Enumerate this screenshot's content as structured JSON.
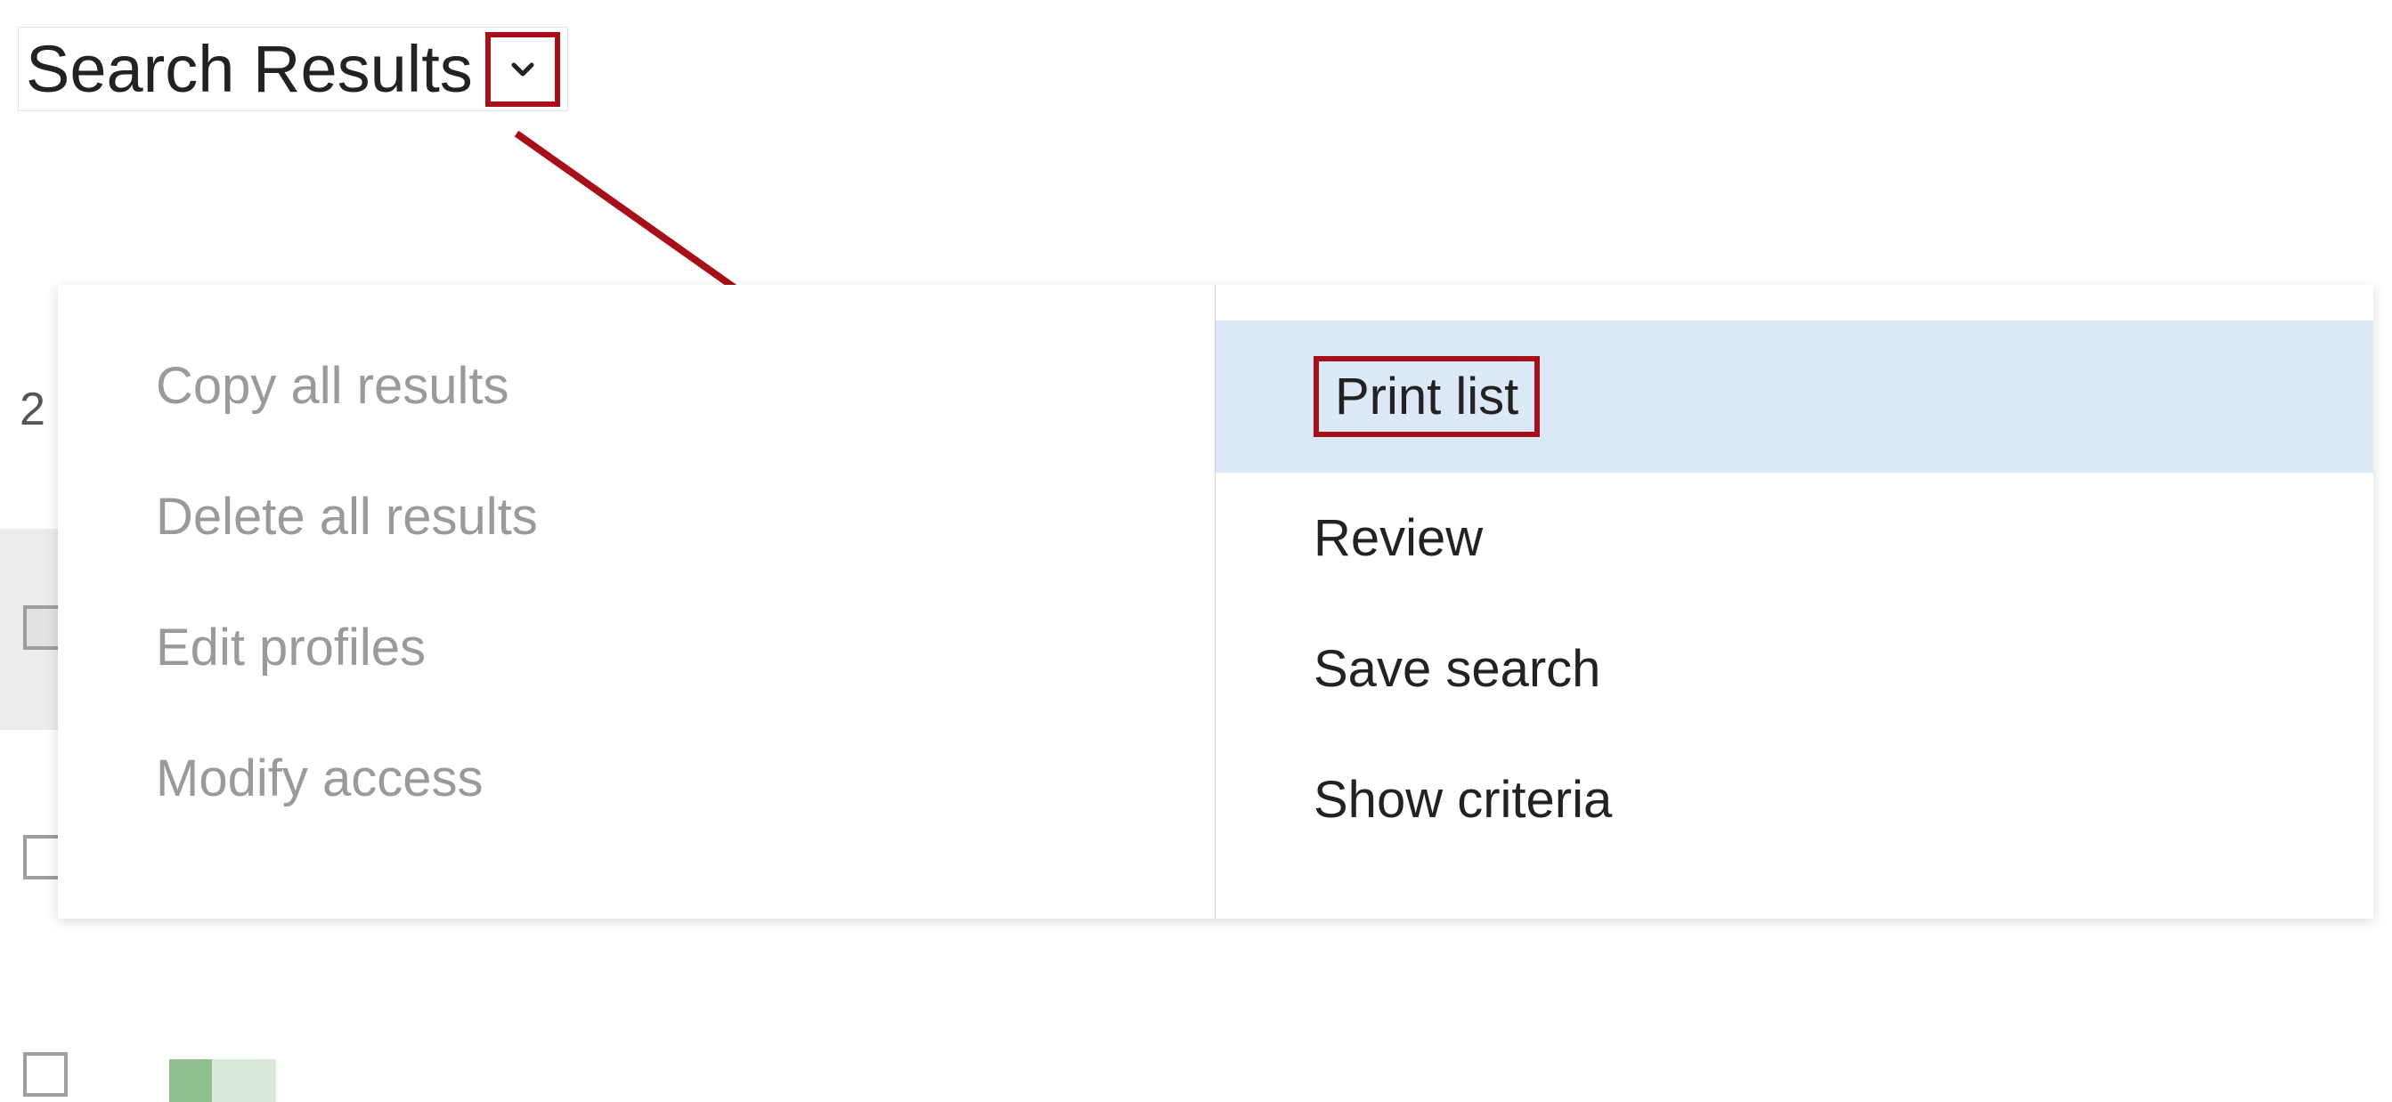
{
  "header": {
    "title": "Search Results"
  },
  "background": {
    "count_fragment": "2"
  },
  "menu": {
    "left": [
      {
        "label": "Copy all results",
        "disabled": true
      },
      {
        "label": "Delete all results",
        "disabled": true
      },
      {
        "label": "Edit profiles",
        "disabled": true
      },
      {
        "label": "Modify access",
        "disabled": true
      }
    ],
    "right": [
      {
        "label": "Print list",
        "highlight": true,
        "redbox": true
      },
      {
        "label": "Review"
      },
      {
        "label": "Save search"
      },
      {
        "label": "Show criteria"
      }
    ]
  },
  "annotation": {
    "arrow_color": "#a80f1a"
  }
}
